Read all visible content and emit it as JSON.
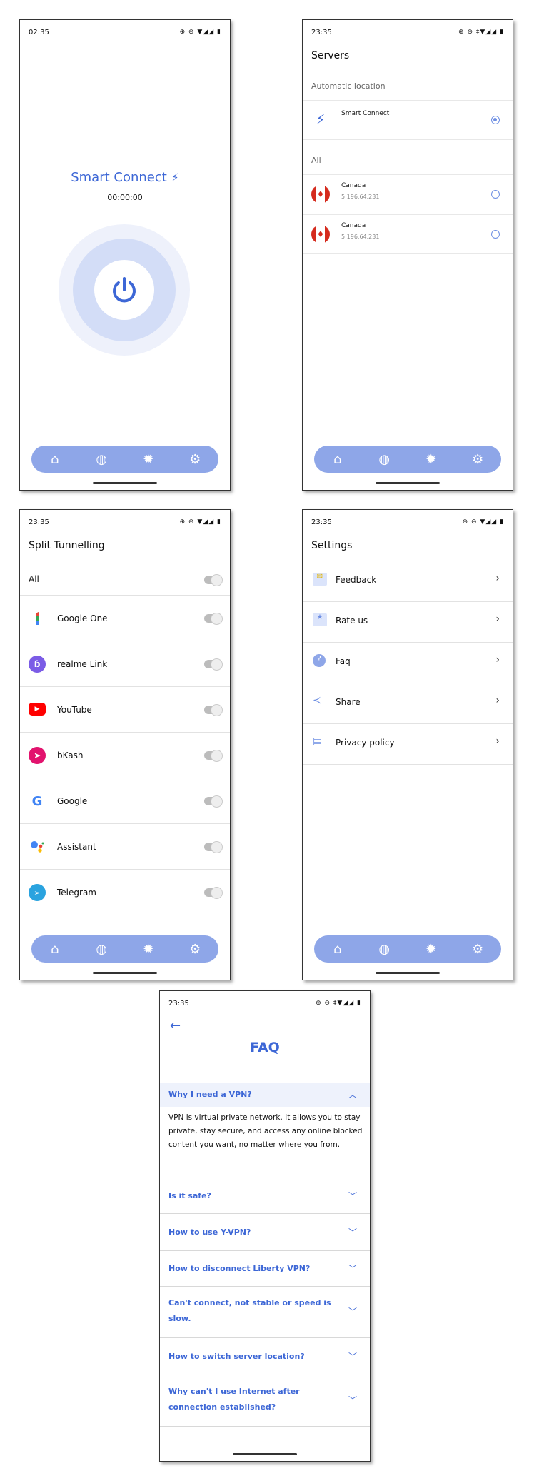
{
  "home": {
    "time": "02:35",
    "status_icons": "⊕ ⊖ ▼◢◢ ▮",
    "title": "Smart Connect",
    "timer": "00:00:00"
  },
  "servers": {
    "time": "23:35",
    "status_icons": "⊕ ⊖ ‡▼◢◢ ▮",
    "title": "Servers",
    "auto_label": "Automatic location",
    "smart_connect": "Smart Connect",
    "all_label": "All",
    "items": [
      {
        "name": "Canada",
        "ip": "5.196.64.231"
      },
      {
        "name": "Canada",
        "ip": "5.196.64.231"
      }
    ]
  },
  "split": {
    "time": "23:35",
    "status_icons": "⊕ ⊖ ▼◢◢ ▮",
    "title": "Split Tunnelling",
    "all_label": "All",
    "apps": [
      "Google One",
      "realme Link",
      "YouTube",
      "bKash",
      "Google",
      "Assistant",
      "Telegram"
    ]
  },
  "settings": {
    "time": "23:35",
    "status_icons": "⊕ ⊖ ▼◢◢ ▮",
    "title": "Settings",
    "items": [
      "Feedback",
      "Rate us",
      "Faq",
      "Share",
      "Privacy policy"
    ]
  },
  "faq": {
    "time": "23:35",
    "status_icons": "⊕ ⊖ ‡▼◢◢ ▮",
    "title": "FAQ",
    "q1": "Why I need a VPN?",
    "a1": "VPN is virtual private network. It allows you to stay private, stay secure, and access any online blocked content you want, no matter where you from.",
    "q2": "Is it safe?",
    "q3": "How to use Y-VPN?",
    "q4": "How to disconnect Liberty VPN?",
    "q5": "Can't connect, not stable or speed is slow.",
    "q6": "How to switch server location?",
    "q7": "Why can't I use Internet after connection established?"
  },
  "colors": {
    "accent": "#3d67d6",
    "nav": "#8ea6e8"
  }
}
